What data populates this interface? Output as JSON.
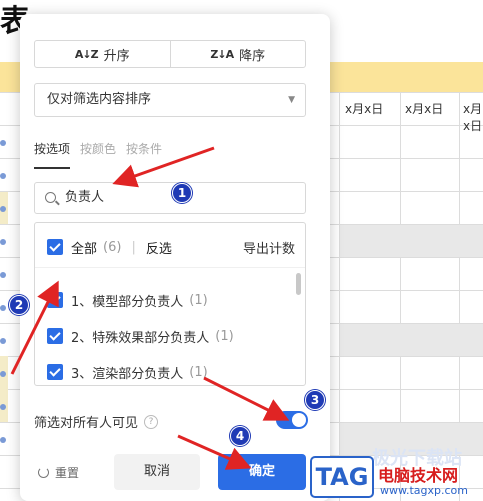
{
  "background": {
    "title_fragment": "表",
    "column_headers": [
      "x月x日",
      "x月x日",
      "x月x日"
    ]
  },
  "panel": {
    "sort": {
      "asc_label": "升序",
      "asc_icon": "A↓Z",
      "desc_label": "降序",
      "desc_icon": "Z↓A"
    },
    "sort_scope": {
      "selected": "仅对筛选内容排序"
    },
    "tabs": [
      {
        "label": "按选项",
        "active": true
      },
      {
        "label": "按颜色",
        "active": false
      },
      {
        "label": "按条件",
        "active": false
      }
    ],
    "search": {
      "value": "负责人"
    },
    "list": {
      "select_all_label": "全部",
      "select_all_count": "(6)",
      "invert_label": "反选",
      "export_label": "导出计数",
      "items": [
        {
          "label": "1、模型部分负责人",
          "count": "(1)",
          "checked": true
        },
        {
          "label": "2、特殊效果部分负责人",
          "count": "(1)",
          "checked": true
        },
        {
          "label": "3、渲染部分负责人",
          "count": "(1)",
          "checked": true
        }
      ]
    },
    "visibility": {
      "label": "筛选对所有人可见",
      "help_icon": "?",
      "enabled": true
    },
    "footer": {
      "reset_label": "重置",
      "cancel_label": "取消",
      "ok_label": "确定"
    }
  },
  "annotations": {
    "badges": [
      "1",
      "2",
      "3",
      "4"
    ],
    "color": "#1f3ab5",
    "arrow_color": "#e02424"
  },
  "watermark": {
    "logo": "TAG",
    "faded": "极光下载站",
    "title": "电脑技术网",
    "url": "www.tagxp.com"
  },
  "colors": {
    "accent": "#2b6de5",
    "header_band": "#fbe49a"
  }
}
